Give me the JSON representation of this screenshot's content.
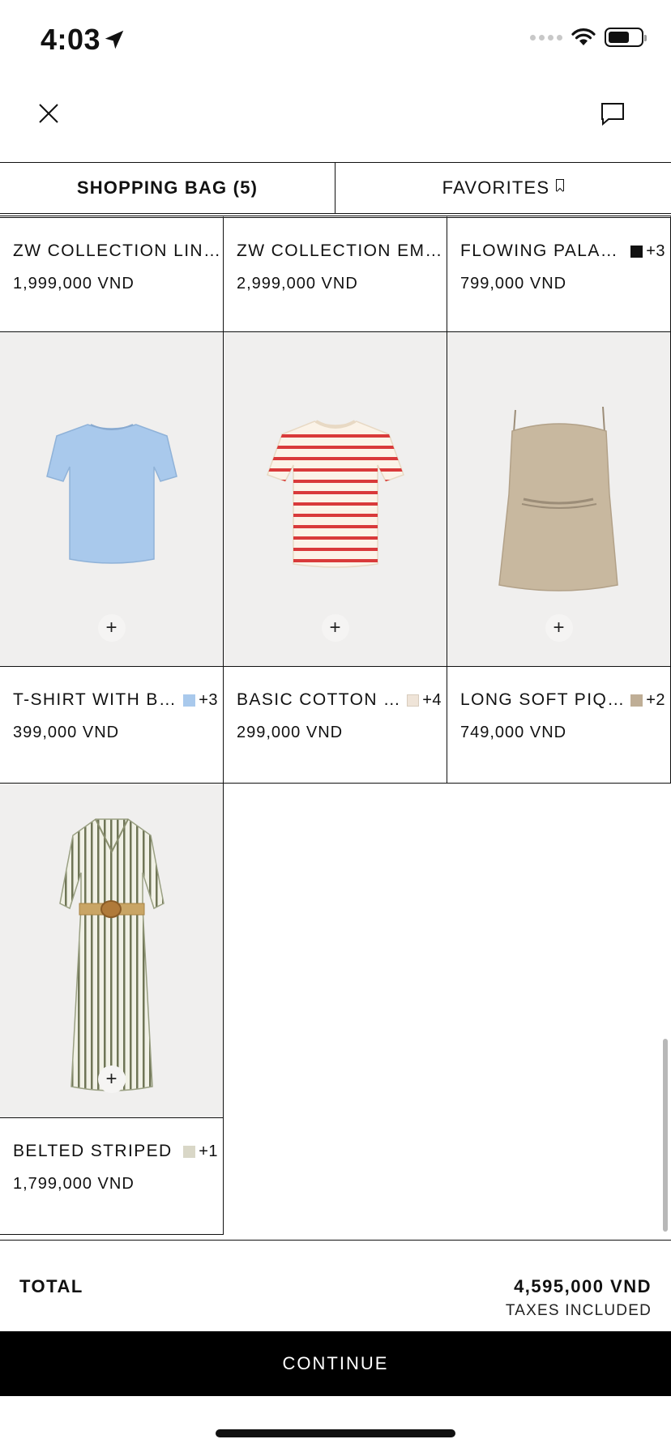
{
  "status_bar": {
    "time": "4:03"
  },
  "tabs": [
    {
      "label": "SHOPPING BAG (5)",
      "active": true
    },
    {
      "label": "FAVORITES",
      "active": false
    }
  ],
  "rows": [
    {
      "products": [
        {
          "name": "ZW COLLECTION LINEN",
          "price": "1,999,000 VND",
          "swatch": "",
          "more": ""
        },
        {
          "name": "ZW COLLECTION EMBROIDERED",
          "price": "2,999,000 VND",
          "swatch": "",
          "more": ""
        },
        {
          "name": "FLOWING PALAZZO",
          "price": "799,000 VND",
          "swatch": "#111111",
          "more": "+3"
        }
      ]
    },
    {
      "products": [
        {
          "name": "T-SHIRT WITH BASIC",
          "price": "399,000 VND",
          "swatch": "#a9c9ec",
          "more": "+3",
          "image": "light-blue-tshirt"
        },
        {
          "name": "BASIC COTTON T-SHIRT",
          "price": "299,000 VND",
          "swatch": "#efe4d8",
          "more": "+4",
          "image": "red-striped-tshirt"
        },
        {
          "name": "LONG SOFT PIQUE",
          "price": "749,000 VND",
          "swatch": "#bfae96",
          "more": "+2",
          "image": "beige-knit-dress"
        }
      ]
    },
    {
      "products": [
        {
          "name": "BELTED STRIPED",
          "price": "1,799,000 VND",
          "swatch": "#d9d7c7",
          "more": "+1",
          "image": "striped-shirt-dress"
        }
      ]
    }
  ],
  "add_symbol": "+",
  "summary": {
    "total_label": "TOTAL",
    "total_value": "4,595,000 VND",
    "taxes_note": "TAXES INCLUDED"
  },
  "continue_label": "CONTINUE",
  "colors": {
    "background": "#ffffff",
    "image_bg": "#f0efee",
    "button": "#000000"
  }
}
